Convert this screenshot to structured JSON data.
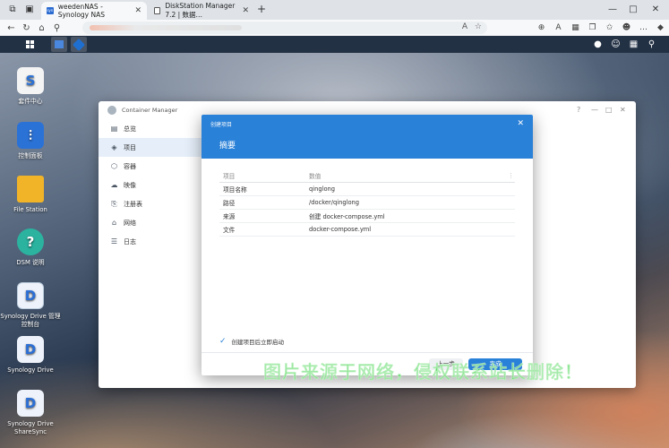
{
  "browser": {
    "tabs": [
      {
        "title": "weedenNAS - Synology NAS",
        "favicon": "synology-icon"
      },
      {
        "title": "DiskStation Manager 7.2 | 数据…",
        "favicon": "dsm-icon"
      }
    ],
    "new_tab": "+",
    "window_controls": {
      "minimize": "—",
      "maximize": "□",
      "close": "✕"
    }
  },
  "desktop": {
    "icons": [
      {
        "label": "套件中心",
        "glyph": "S",
        "color": "#f4f4f4"
      },
      {
        "label": "控制面板",
        "glyph": "⫶",
        "color": "#2b72d6"
      },
      {
        "label": "File Station",
        "glyph": "",
        "color": "#f1b428"
      },
      {
        "label": "DSM 说明",
        "glyph": "?",
        "color": "#2bb3a0"
      },
      {
        "label": "Synology Drive 管理控制台",
        "glyph": "D",
        "color": "#2b6fd6"
      },
      {
        "label": "Synology Drive",
        "glyph": "D",
        "color": "#2b6fd6"
      },
      {
        "label": "Synology Drive ShareSync",
        "glyph": "D",
        "color": "#2b6fd6"
      }
    ]
  },
  "container_manager": {
    "title": "Container Manager",
    "sidebar": [
      {
        "label": "总览",
        "icon": "overview-icon",
        "glyph": "▤"
      },
      {
        "label": "项目",
        "icon": "project-icon",
        "glyph": "◈"
      },
      {
        "label": "容器",
        "icon": "container-icon",
        "glyph": "⬡"
      },
      {
        "label": "映像",
        "icon": "image-icon",
        "glyph": "☁"
      },
      {
        "label": "注册表",
        "icon": "registry-icon",
        "glyph": "⎘"
      },
      {
        "label": "网络",
        "icon": "network-icon",
        "glyph": "⌂"
      },
      {
        "label": "日志",
        "icon": "log-icon",
        "glyph": "☰"
      }
    ]
  },
  "dialog": {
    "window_title": "创建项目",
    "heading": "摘要",
    "close": "✕",
    "table": {
      "headers": [
        "项目",
        "数值"
      ],
      "rows": [
        [
          "项目名称",
          "qinglong"
        ],
        [
          "路径",
          "/docker/qinglong"
        ],
        [
          "来源",
          "创建 docker-compose.yml"
        ],
        [
          "文件",
          "docker-compose.yml"
        ]
      ]
    },
    "autostart_label": "创建项目后立即启动",
    "buttons": {
      "prev": "上一步",
      "done": "完成"
    }
  },
  "watermark": "图片来源于网络，侵权联系站长删除！",
  "colors": {
    "accent": "#2a81d8",
    "watermark": "#3cd246"
  }
}
